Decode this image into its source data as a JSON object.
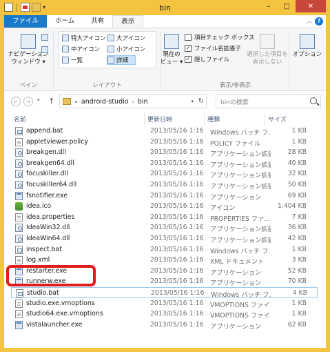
{
  "window": {
    "title": "bin",
    "controls": {
      "minimize": "–",
      "maximize": "□",
      "close": "✕"
    }
  },
  "ribbon": {
    "tabs": [
      {
        "label": "ファイル"
      },
      {
        "label": "ホーム"
      },
      {
        "label": "共有"
      },
      {
        "label": "表示"
      }
    ],
    "pane_group": {
      "nav_pane_line1": "ナビゲーション",
      "nav_pane_line2": "ウィンドウ ▾",
      "label": "ペイン"
    },
    "layout_group": {
      "items": [
        "特大アイコン",
        "大アイコン",
        "中アイコン",
        "小アイコン",
        "一覧",
        "詳細"
      ],
      "label": "レイアウト"
    },
    "current_view": {
      "line1": "現在の",
      "line2": "ビュー ▾"
    },
    "show_hide_group": {
      "item_checkboxes": "項目チェック ボックス",
      "file_extensions": "ファイル名拡張子",
      "hidden_files": "隠しファイル",
      "hide_selected_line1": "選択した項目を",
      "hide_selected_line2": "表示しない",
      "label": "表示/非表示"
    },
    "options": "オプション",
    "help": "?"
  },
  "navigation": {
    "back": "←",
    "forward": "→",
    "up": "↑",
    "breadcrumb_prefix": "«",
    "breadcrumb": [
      "android-studio",
      "bin"
    ],
    "refresh": "↻",
    "search_placeholder": "binの検索"
  },
  "columns": {
    "name": "名前",
    "date": "更新日時",
    "type": "種類",
    "size": "サイズ"
  },
  "files": [
    {
      "name": "append.bat",
      "date": "2013/05/16 1:16",
      "type": "Windows バッチ フ...",
      "size": "1 KB",
      "icon": "bat"
    },
    {
      "name": "appletviewer.policy",
      "date": "2013/05/16 1:16",
      "type": "POLICY ファイル",
      "size": "1 KB",
      "icon": "plain"
    },
    {
      "name": "breakgen.dll",
      "date": "2013/05/16 1:16",
      "type": "アプリケーション拡張",
      "size": "28 KB",
      "icon": "dll"
    },
    {
      "name": "breakgen64.dll",
      "date": "2013/05/16 1:16",
      "type": "アプリケーション拡張",
      "size": "40 KB",
      "icon": "dll"
    },
    {
      "name": "focuskiller.dll",
      "date": "2013/05/16 1:16",
      "type": "アプリケーション拡張",
      "size": "32 KB",
      "icon": "dll"
    },
    {
      "name": "focuskiller64.dll",
      "date": "2013/05/16 1:16",
      "type": "アプリケーション拡張",
      "size": "50 KB",
      "icon": "dll"
    },
    {
      "name": "fsnotifier.exe",
      "date": "2013/05/16 1:16",
      "type": "アプリケーション",
      "size": "69 KB",
      "icon": "exe"
    },
    {
      "name": "idea.ico",
      "date": "2013/05/16 1:16",
      "type": "アイコン",
      "size": "1,404 KB",
      "icon": "ico"
    },
    {
      "name": "idea.properties",
      "date": "2013/05/16 1:16",
      "type": "PROPERTIES ファ...",
      "size": "7 KB",
      "icon": "plain"
    },
    {
      "name": "IdeaWin32.dll",
      "date": "2013/05/16 1:16",
      "type": "アプリケーション拡張",
      "size": "36 KB",
      "icon": "dll"
    },
    {
      "name": "IdeaWin64.dll",
      "date": "2013/05/16 1:16",
      "type": "アプリケーション拡張",
      "size": "42 KB",
      "icon": "dll"
    },
    {
      "name": "inspect.bat",
      "date": "2013/05/16 1:16",
      "type": "Windows バッチ フ...",
      "size": "1 KB",
      "icon": "bat"
    },
    {
      "name": "log.xml",
      "date": "2013/05/16 1:16",
      "type": "XML ドキュメント",
      "size": "3 KB",
      "icon": "plain"
    },
    {
      "name": "restarter.exe",
      "date": "2013/05/16 1:16",
      "type": "アプリケーション",
      "size": "52 KB",
      "icon": "exe"
    },
    {
      "name": "runnerw.exe",
      "date": "2013/05/16 1:16",
      "type": "アプリケーション",
      "size": "70 KB",
      "icon": "exe"
    },
    {
      "name": "studio.bat",
      "date": "2013/05/16 1:16",
      "type": "Windows バッチ フ...",
      "size": "4 KB",
      "icon": "bat"
    },
    {
      "name": "studio.exe.vmoptions",
      "date": "2013/05/16 1:16",
      "type": "VMOPTIONS ファイル",
      "size": "1 KB",
      "icon": "plain"
    },
    {
      "name": "studio64.exe.vmoptions",
      "date": "2013/05/16 1:16",
      "type": "VMOPTIONS ファイル",
      "size": "1 KB",
      "icon": "plain"
    },
    {
      "name": "vistalauncher.exe",
      "date": "2013/05/16 1:16",
      "type": "アプリケーション",
      "size": "62 KB",
      "icon": "exe"
    }
  ],
  "selected_file": "studio.bat",
  "colors": {
    "frame": "#f4c441",
    "file_tab": "#1979ca",
    "highlight": "#e31b1b",
    "selection_border": "#99c9ef"
  }
}
